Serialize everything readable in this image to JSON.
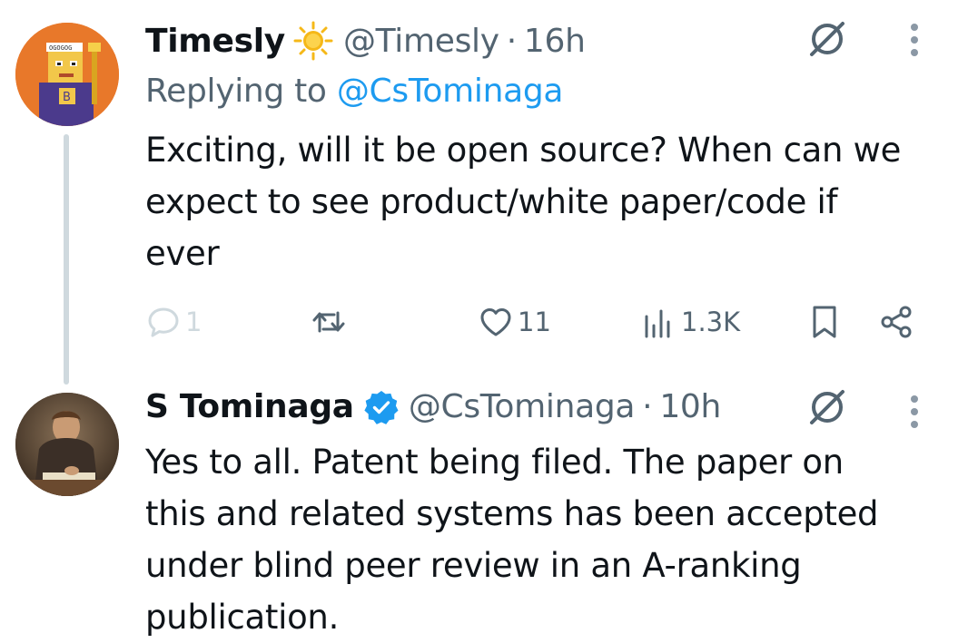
{
  "tweets": [
    {
      "name": "Timesly",
      "handle": "@Timesly",
      "separator": "·",
      "time": "16h",
      "replying_prefix": "Replying to",
      "replying_mention": "@CsTominaga",
      "body_lines": [
        "Exciting, will it be open source? When can we",
        "expect to see product/white paper/code if",
        "ever"
      ],
      "actions": {
        "replies": "1",
        "retweets": "",
        "likes": "11",
        "views": "1.3K"
      }
    },
    {
      "name": "S Tominaga",
      "handle": "@CsTominaga",
      "separator": "·",
      "time": "10h",
      "body_lines": [
        "Yes to all. Patent being filed. The paper on",
        "this and related systems has been accepted",
        "under blind peer review in an A-ranking",
        "publication."
      ]
    }
  ],
  "icons": {
    "sun_emoji": "sun-emoji-icon",
    "verified_badge": "verified-badge-icon",
    "grok": "grok-icon",
    "more": "more-options-icon",
    "reply": "reply-icon",
    "retweet": "retweet-icon",
    "like": "heart-icon",
    "views": "views-chart-icon",
    "bookmark": "bookmark-icon",
    "share": "share-icon"
  },
  "colors": {
    "text": "#0f1419",
    "secondary": "#536471",
    "link": "#1d9bf0",
    "thread_line": "#cfd9de",
    "verified": "#1d9bf0",
    "emoji_sun": "#f5b818"
  }
}
